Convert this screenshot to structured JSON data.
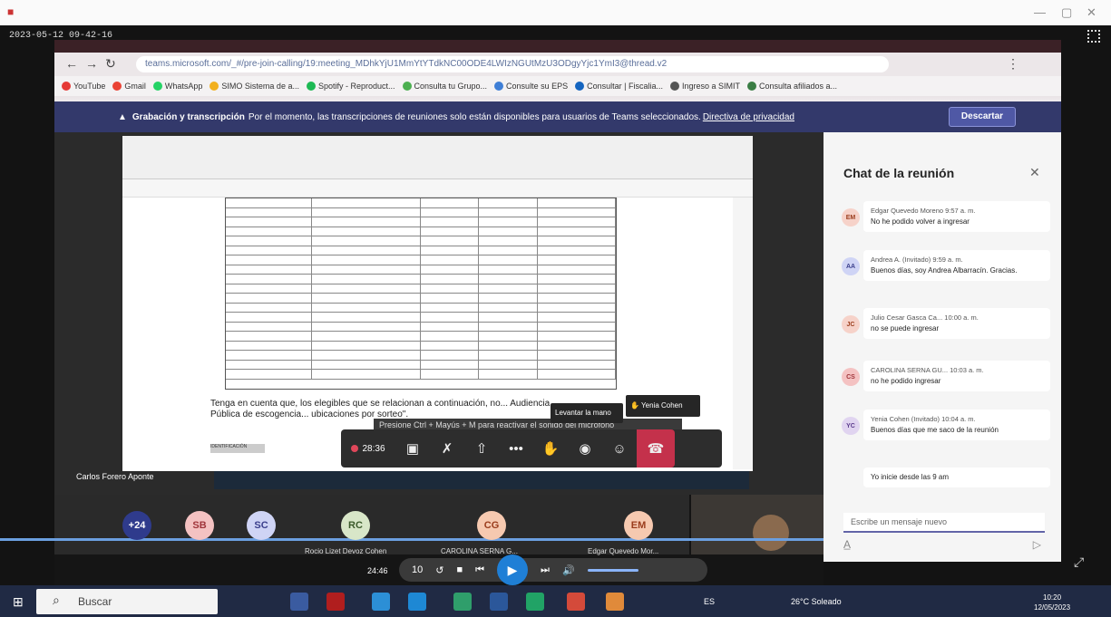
{
  "recording_timestamp": "2023-05-12 09-42-16",
  "browser": {
    "url": "teams.microsoft.com/_#/pre-join-calling/19:meeting_MDhkYjU1MmYtYTdkNC00ODE4LWIzNGUtMzU3ODgyYjc1YmI3@thread.v2",
    "bookmarks": [
      "YouTube",
      "Gmail",
      "WhatsApp",
      "SIMO Sistema de a...",
      "Spotify - Reproduct...",
      "Consulta tu Grupo...",
      "Consulte su EPS",
      "Consultar | Fiscalia...",
      "Ingreso a SIMIT",
      "Consulta afiliados a..."
    ]
  },
  "banner": {
    "bold": "Grabación y transcripción",
    "text": "Por el momento, las transcripciones de reuniones solo están disponibles para usuarios de Teams seleccionados.",
    "link": "Directiva de privacidad",
    "dismiss": "Descartar"
  },
  "shared_doc": {
    "paragraph": "Tenga en cuenta que, los elegibles que se relacionan a continuación, no... Audiencia Pública de escogencia... ubicaciones por sorteo\".",
    "column_header": "IDENTIFICACIÓN"
  },
  "tooltip": "Levantar la mano",
  "raised_by": "Yenia Cohen",
  "shortcut_hint": "Presione Ctrl + Mayús + M para reactivar el sonido del micrófono",
  "meeting": {
    "elapsed": "28:36",
    "presenter": "Carlos Forero Aponte"
  },
  "participants": [
    {
      "initials": "+24",
      "color": "#2f3b8c",
      "fg": "#fff",
      "name": ""
    },
    {
      "initials": "SB",
      "color": "#f4c2c2",
      "fg": "#a0353b",
      "name": ""
    },
    {
      "initials": "SC",
      "color": "#cfd4f5",
      "fg": "#3b3f8c",
      "name": ""
    },
    {
      "initials": "RC",
      "color": "#d8e6c8",
      "fg": "#3b5a2b",
      "name": "Rocio Lizet Devoz Cohen"
    },
    {
      "initials": "CG",
      "color": "#f6c9b0",
      "fg": "#9a3c1c",
      "name": "CAROLINA SERNA G..."
    },
    {
      "initials": "EM",
      "color": "#f6c9b0",
      "fg": "#9a3c1c",
      "name": "Edgar Quevedo Mor..."
    }
  ],
  "chat": {
    "title": "Chat de la reunión",
    "compose_placeholder": "Escribe un mensaje nuevo",
    "messages": [
      {
        "initials": "EM",
        "color": "#f6d2c9",
        "fg": "#9a3c1c",
        "who": "Edgar Quevedo Moreno  9:57 a. m.",
        "text": "No he podido volver a ingresar"
      },
      {
        "initials": "AA",
        "color": "#cfd4f5",
        "fg": "#3b3f8c",
        "who": "Andrea A. (Invitado)  9:59 a. m.",
        "text": "Buenos días, soy Andrea Albarracín. Gracias."
      },
      {
        "initials": "JC",
        "color": "#f6d2c9",
        "fg": "#9a3c1c",
        "who": "Julio Cesar Gasca Ca...  10:00 a. m.",
        "text": "no se puede ingresar"
      },
      {
        "initials": "CS",
        "color": "#f4c2c2",
        "fg": "#a0353b",
        "who": "CAROLINA SERNA GU...  10:03 a. m.",
        "text": "no he podido ingresar"
      },
      {
        "initials": "YC",
        "color": "#e0d4f0",
        "fg": "#5b3b8c",
        "who": "Yenia Cohen (Invitado)  10:04 a. m.",
        "text": "Buenos días que me saco de la reunión"
      },
      {
        "initials": "",
        "color": "",
        "fg": "",
        "who": "",
        "text": "Yo inicie desde las 9 am"
      }
    ]
  },
  "player": {
    "time": "24:46",
    "skip_back": "10"
  },
  "taskbar": {
    "search": "Buscar",
    "weather": "26°C  Soleado",
    "lang": "ES",
    "time": "10:20",
    "date": "12/05/2023"
  }
}
